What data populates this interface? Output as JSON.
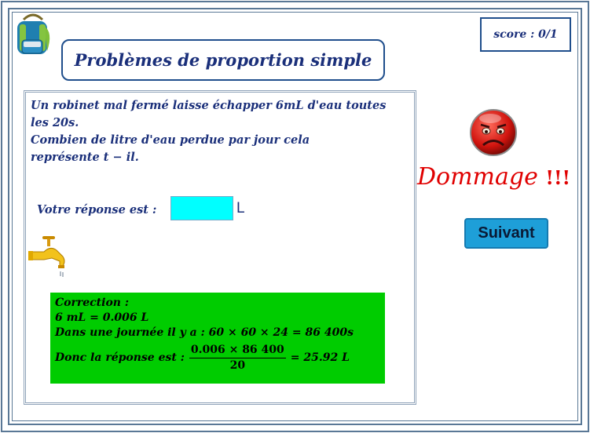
{
  "header": {
    "title": "Problèmes de proportion simple",
    "score": "score : 0/1"
  },
  "question": {
    "line1": "Un robinet mal fermé laisse échapper 6mL d'eau toutes",
    "line2": "les 20s.",
    "line3": "Combien de litre d'eau perdue par jour cela",
    "line4": "représente t − il.",
    "answer_label": "Votre réponse est :",
    "answer_value": "",
    "unit": "L"
  },
  "correction": {
    "heading": "Correction :",
    "line1": "6 mL = 0.006 L",
    "line2": "Dans une journée il y a : 60 × 60 × 24 = 86 400s",
    "line3_prefix": "Donc la réponse est :",
    "fraction_numerator": "0.006 × 86 400",
    "fraction_denominator": "20",
    "line3_result": "= 25.92 L"
  },
  "feedback": {
    "message": "Dommage",
    "exclamation": "!!!",
    "next_label": "Suivant"
  },
  "colors": {
    "accent": "#1a2f7a",
    "correction_bg": "#00cc00",
    "input_bg": "#00ffff",
    "error": "#e00000",
    "button": "#1e9fd8"
  },
  "icons": [
    "backpack-icon",
    "faucet-icon",
    "sad-face-icon"
  ]
}
